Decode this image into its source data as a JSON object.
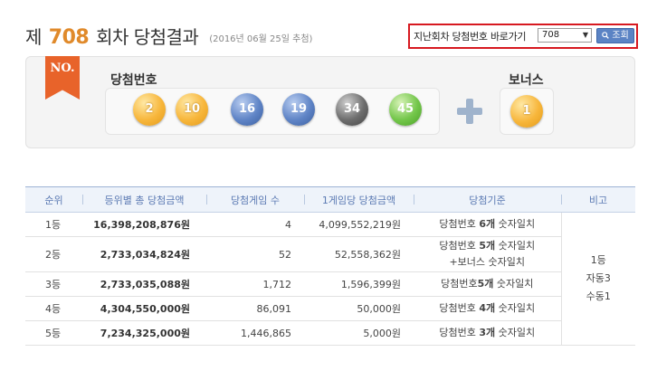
{
  "header": {
    "prefix": "제",
    "round": "708",
    "suffix": "회차 당첨결과",
    "draw_date": "(2016년 06월 25일 추첨)"
  },
  "past_round": {
    "label": "지난회차 당첨번호 바로가기",
    "selected": "708",
    "search_label": "조회"
  },
  "winning": {
    "ribbon": "NO.",
    "numbers_label": "당첨번호",
    "bonus_label": "보너스",
    "numbers": [
      {
        "value": "2",
        "color": "#f7b63b"
      },
      {
        "value": "10",
        "color": "#f7b63b"
      },
      {
        "value": "16",
        "color": "#5f84c6"
      },
      {
        "value": "19",
        "color": "#5f84c6"
      },
      {
        "value": "34",
        "color": "#6d6d6d"
      },
      {
        "value": "45",
        "color": "#73c64a"
      }
    ],
    "bonus": {
      "value": "1",
      "color": "#f7b63b"
    }
  },
  "table": {
    "headers": [
      "순위",
      "등위별 총 당첨금액",
      "당첨게임 수",
      "1게임당 당첨금액",
      "당첨기준",
      "비고"
    ],
    "rows": [
      {
        "rank": "1등",
        "total": "16,398,208,876원",
        "count": "4",
        "per_game": "4,099,552,219원",
        "crit_a": "당첨번호 ",
        "crit_b": "6개",
        "crit_c": " 숫자일치",
        "crit_line2": ""
      },
      {
        "rank": "2등",
        "total": "2,733,034,824원",
        "count": "52",
        "per_game": "52,558,362원",
        "crit_a": "당첨번호 ",
        "crit_b": "5개",
        "crit_c": " 숫자일치",
        "crit_line2": "+보너스 숫자일치"
      },
      {
        "rank": "3등",
        "total": "2,733,035,088원",
        "count": "1,712",
        "per_game": "1,596,399원",
        "crit_a": "당첨번호",
        "crit_b": "5개",
        "crit_c": " 숫자일치",
        "crit_line2": ""
      },
      {
        "rank": "4등",
        "total": "4,304,550,000원",
        "count": "86,091",
        "per_game": "50,000원",
        "crit_a": "당첨번호 ",
        "crit_b": "4개",
        "crit_c": " 숫자일치",
        "crit_line2": ""
      },
      {
        "rank": "5등",
        "total": "7,234,325,000원",
        "count": "1,446,865",
        "per_game": "5,000원",
        "crit_a": "당첨번호 ",
        "crit_b": "3개",
        "crit_c": " 숫자일치",
        "crit_line2": ""
      }
    ],
    "note": [
      "1등",
      "자동3",
      "수동1"
    ]
  }
}
